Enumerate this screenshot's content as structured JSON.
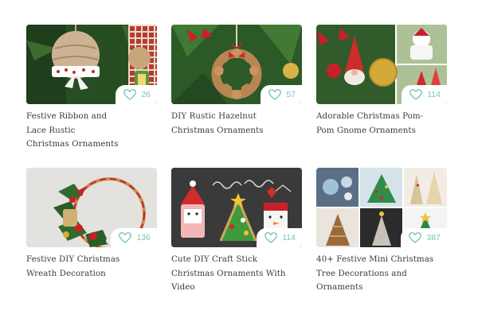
{
  "cards": [
    {
      "title": "Festive Ribbon and Lace Rustic Christmas Ornaments",
      "likes": "26",
      "image": "ribbon-lace-ornament"
    },
    {
      "title": "DIY Rustic Hazelnut Christmas Ornaments",
      "likes": "57",
      "image": "hazelnut-wreath-ornament"
    },
    {
      "title": "Adorable Christmas Pom-Pom Gnome Ornaments",
      "likes": "114",
      "image": "pom-pom-gnome-ornaments"
    },
    {
      "title": "Festive DIY Christmas Wreath Decoration",
      "likes": "136",
      "image": "embroidery-hoop-wreath"
    },
    {
      "title": "Cute DIY Craft Stick Christmas Ornaments With Video",
      "likes": "114",
      "image": "craft-stick-ornaments"
    },
    {
      "title": "40+ Festive Mini Christmas Tree Decorations and Ornaments",
      "likes": "387",
      "image": "mini-tree-collage"
    }
  ],
  "colors": {
    "accent": "#74c7b8",
    "title_text": "#3b3b3b",
    "background": "#ffffff"
  },
  "icons": {
    "like": "heart-outline-icon"
  }
}
